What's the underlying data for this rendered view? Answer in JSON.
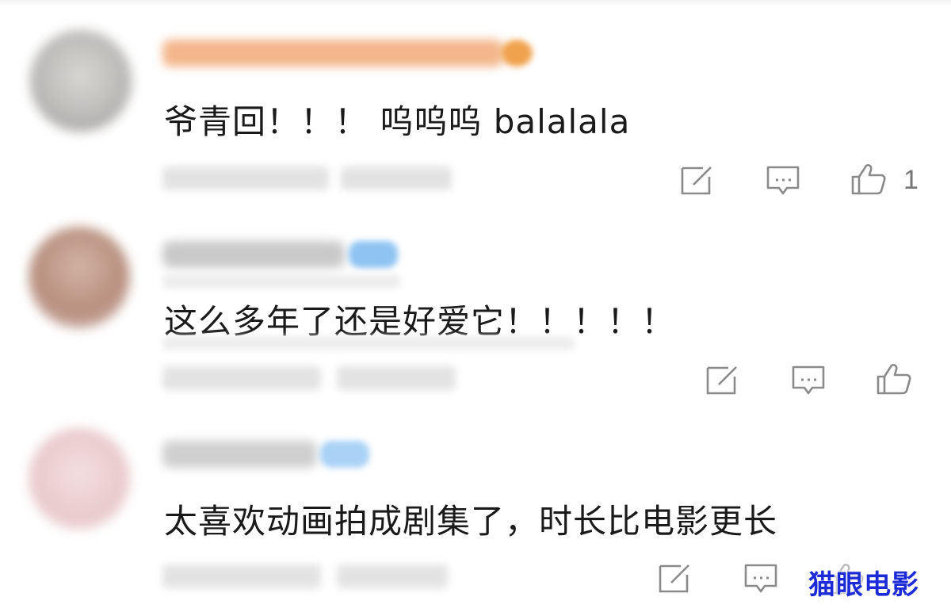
{
  "comments": [
    {
      "text": "爷青回！！！ 呜呜呜 balalala",
      "like_count": "1",
      "avatar_color": "#bdbbb8",
      "username_color": "#f3b58a",
      "badge_color": "#f0a24c"
    },
    {
      "text": "这么多年了还是好爱它！！！！！",
      "like_count": "",
      "avatar_color": "#b88f7e",
      "username_color": "#c9c9c9",
      "badge_color": "#8ec3f2"
    },
    {
      "text": "太喜欢动画拍成剧集了，时长比电影更长",
      "like_count": "",
      "avatar_color": "#e9c9cc",
      "username_color": "#cfcfcf",
      "badge_color": "#a9d2f6"
    }
  ],
  "icons": {
    "edit": "edit-icon",
    "reply": "comment-icon",
    "like": "thumbs-up-icon"
  },
  "watermark": {
    "text": "猫眼电影",
    "color": "#1c2bd6"
  }
}
